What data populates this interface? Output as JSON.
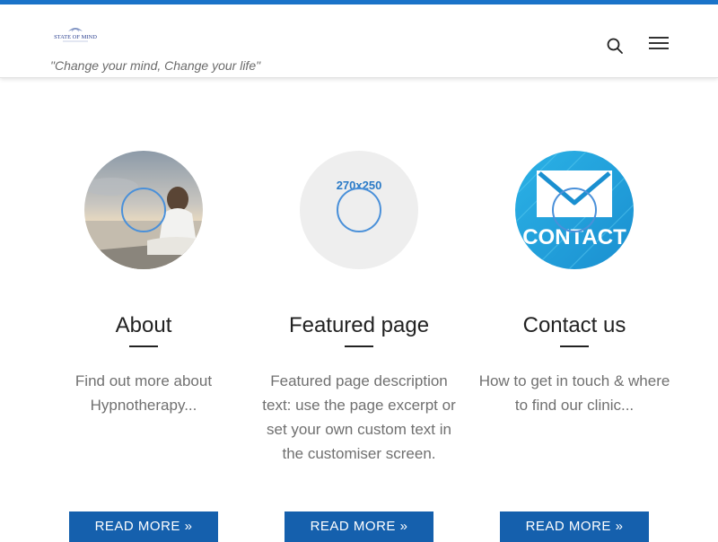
{
  "header": {
    "logo_text": "STATE OF MIND",
    "tagline": "\"Change your mind, Change your life\""
  },
  "colors": {
    "top_stripe": "#1a73c9",
    "button": "#1560ad",
    "hover_ring": "#4a90d9"
  },
  "cards": [
    {
      "title": "About",
      "description": "Find out more about Hypnotherapy...",
      "button": "READ MORE »",
      "image": "meditation-photo"
    },
    {
      "title": "Featured page",
      "description": "Featured page description text: use the page excerpt or set your own custom text in the customiser screen.",
      "button": "READ MORE »",
      "image": "placeholder",
      "image_label": "270x250"
    },
    {
      "title": "Contact us",
      "description": "How to get in touch & where to find our clinic...",
      "button": "READ MORE »",
      "image": "contact-envelope",
      "image_label": "CONTACT"
    }
  ]
}
